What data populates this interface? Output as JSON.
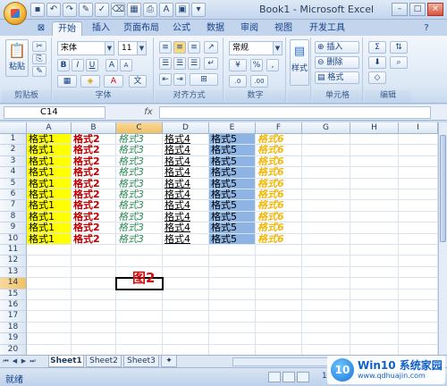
{
  "window": {
    "title": "Book1 - Microsoft Excel"
  },
  "qat": [
    "save-icon",
    "undo-icon",
    "redo-icon",
    "paint-icon"
  ],
  "tabs": [
    "开始",
    "插入",
    "页面布局",
    "公式",
    "数据",
    "审阅",
    "视图",
    "开发工具"
  ],
  "active_tab": "开始",
  "ribbon": {
    "clipboard": {
      "paste": "粘贴",
      "label": "剪贴板"
    },
    "font": {
      "name": "宋体",
      "size": "11",
      "bold": "B",
      "italic": "I",
      "underline": "U",
      "grow": "A",
      "shrink": "A",
      "label": "字体"
    },
    "alignment": {
      "label": "对齐方式"
    },
    "number": {
      "format": "常规",
      "percent": "%",
      "comma": ",",
      "label": "数字"
    },
    "styles": {
      "button": "样式"
    },
    "cells": {
      "insert": "插入",
      "delete": "删除",
      "format": "格式",
      "label": "单元格"
    },
    "editing": {
      "sum": "Σ",
      "label": "编辑"
    }
  },
  "formula_bar": {
    "name_box": "C14",
    "fx": "fx",
    "value": ""
  },
  "columns": [
    "A",
    "B",
    "C",
    "D",
    "E",
    "F",
    "G",
    "H",
    "I"
  ],
  "rows": [
    "1",
    "2",
    "3",
    "4",
    "5",
    "6",
    "7",
    "8",
    "9",
    "10",
    "11",
    "12",
    "13",
    "14",
    "15",
    "16",
    "17",
    "18",
    "19",
    "20",
    "21"
  ],
  "selected": {
    "column": "C",
    "row": "14"
  },
  "cell_data": {
    "A": "格式1",
    "B": "格式2",
    "C": "格式3",
    "D": "格式4",
    "E": "格式5",
    "F": "格式6",
    "filled_rows": 10
  },
  "annotation": "图2",
  "sheet_tabs": [
    "Sheet1",
    "Sheet2",
    "Sheet3"
  ],
  "active_sheet": "Sheet1",
  "status": {
    "ready": "就绪",
    "zoom": "100%"
  },
  "watermark": {
    "logo": "10",
    "title": "Win10 系统家园",
    "url": "www.qdhuajin.com"
  }
}
